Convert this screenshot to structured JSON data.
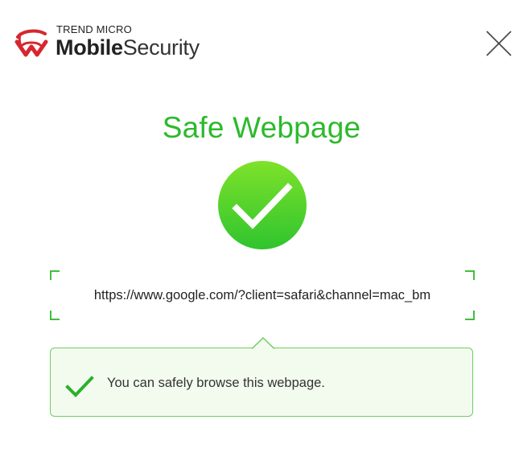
{
  "header": {
    "brand_small": "TREND MICRO",
    "brand_bold": "Mobile",
    "brand_light": "Security",
    "logo_icon": "trend-micro-logo-icon",
    "close_icon": "close-icon"
  },
  "result": {
    "title": "Safe Webpage",
    "status_icon": "checkmark-circle-icon",
    "url": "https://www.google.com/?client=safari&channel=mac_bm",
    "message": "You can safely browse this webpage.",
    "message_icon": "checkmark-icon"
  },
  "colors": {
    "accent_green": "#2cba2c",
    "circle_green_top": "#7ee22a",
    "circle_green_bottom": "#2fc42f",
    "callout_bg": "#f3fbef",
    "callout_border": "#6fcf5f",
    "logo_red": "#d7262f"
  }
}
